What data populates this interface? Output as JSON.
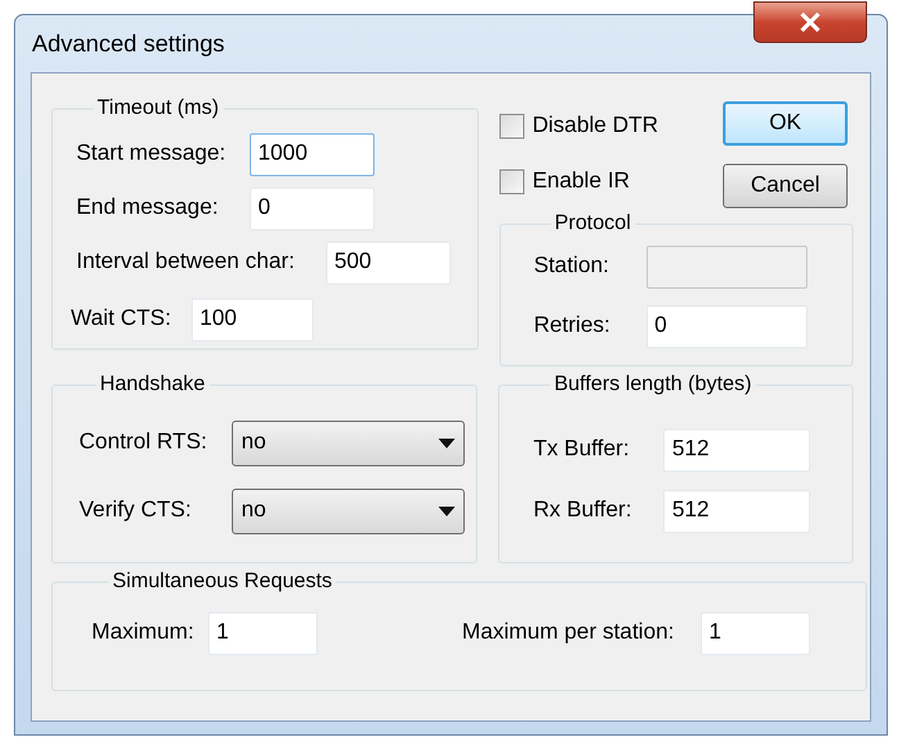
{
  "window": {
    "title": "Advanced settings"
  },
  "timeout": {
    "title": "Timeout (ms)",
    "fields": [
      {
        "label": "Start message:",
        "value": "1000",
        "focused": true
      },
      {
        "label": "End message:",
        "value": "0",
        "focused": false
      },
      {
        "label": "Interval between char:",
        "value": "500",
        "focused": false
      },
      {
        "label": "Wait CTS:",
        "value": "100",
        "focused": false
      }
    ]
  },
  "checkboxes": [
    {
      "label": "Disable DTR",
      "checked": false
    },
    {
      "label": "Enable IR",
      "checked": false
    }
  ],
  "buttons": [
    {
      "label": "OK",
      "default": true
    },
    {
      "label": "Cancel",
      "default": false
    }
  ],
  "protocol": {
    "title": "Protocol",
    "fields": [
      {
        "label": "Station:",
        "disabled": true
      },
      {
        "label": "Retries:",
        "value": "0",
        "disabled": false
      }
    ]
  },
  "handshake": {
    "title": "Handshake",
    "selects": [
      {
        "label": "Control RTS:",
        "value": "no"
      },
      {
        "label": "Verify CTS:",
        "value": "no"
      }
    ]
  },
  "buffers": {
    "title": "Buffers length (bytes)",
    "fields": [
      {
        "label": "Tx Buffer:",
        "value": "512"
      },
      {
        "label": "Rx Buffer:",
        "value": "512"
      }
    ]
  },
  "simultaneous": {
    "title": "Simultaneous Requests",
    "fields": [
      {
        "label": "Maximum:",
        "value": "1"
      },
      {
        "label": "Maximum per station:",
        "value": "1"
      }
    ]
  }
}
